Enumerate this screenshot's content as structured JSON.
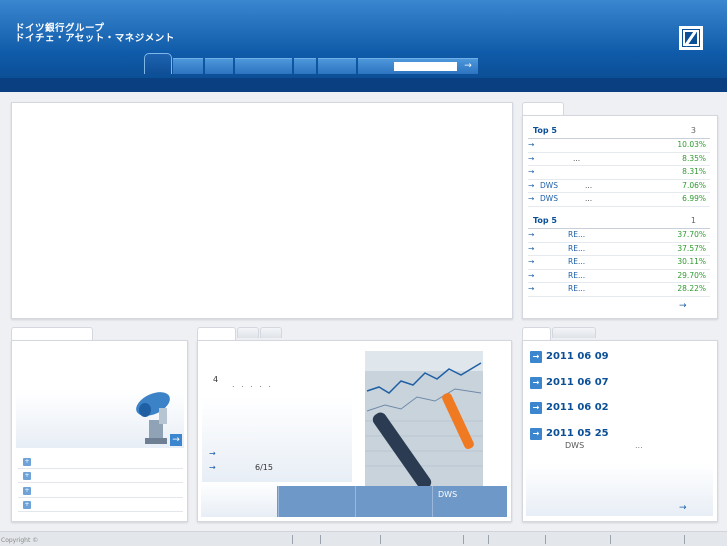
{
  "header": {
    "brand_line1": "ドイツ銀行グループ",
    "brand_line2": "ドイチェ・アセット・マネジメント",
    "logo": "deutsche-bank-slash-logo",
    "search_go": "→"
  },
  "ranking": {
    "group1": {
      "title": "Top 5",
      "count": "3",
      "rows": [
        {
          "arrow": "→",
          "name": "",
          "dots": "",
          "value": "10.03%"
        },
        {
          "arrow": "→",
          "name": "",
          "dots": "...",
          "value": "8.35%"
        },
        {
          "arrow": "→",
          "name": "",
          "dots": "",
          "value": "8.31%"
        },
        {
          "arrow": "→",
          "name": "DWS",
          "dots": "...",
          "value": "7.06%"
        },
        {
          "arrow": "→",
          "name": "DWS",
          "dots": "...",
          "value": "6.99%"
        }
      ]
    },
    "group2": {
      "title": "Top 5",
      "count": "1",
      "rows": [
        {
          "arrow": "→",
          "name": "RE...",
          "value": "37.70%"
        },
        {
          "arrow": "→",
          "name": "RE...",
          "value": "37.57%"
        },
        {
          "arrow": "→",
          "name": "RE...",
          "value": "30.11%"
        },
        {
          "arrow": "→",
          "name": "RE...",
          "value": "29.70%"
        },
        {
          "arrow": "→",
          "name": "RE...",
          "value": "28.22%"
        }
      ]
    },
    "more_arrow": "→"
  },
  "left_panel": {
    "promo_arrow": "→",
    "list_icon": "+"
  },
  "middle_panel": {
    "count_text": "4",
    "dots_text": ". . . . .",
    "link1_arrow": "→",
    "link2_arrow": "→",
    "link2_text": "6/15",
    "bottom_tab4": "DWS"
  },
  "news": {
    "items": [
      {
        "icon": "→",
        "date": "2011  06  09",
        "sub": ""
      },
      {
        "icon": "→",
        "date": "2011  06  07",
        "sub": ""
      },
      {
        "icon": "→",
        "date": "2011  06  02",
        "sub": ""
      },
      {
        "icon": "→",
        "date": "2011  05  25",
        "sub": "DWS",
        "dots": "..."
      }
    ],
    "more_arrow": "→"
  },
  "footer": {
    "copyright": "Copyright ©"
  }
}
